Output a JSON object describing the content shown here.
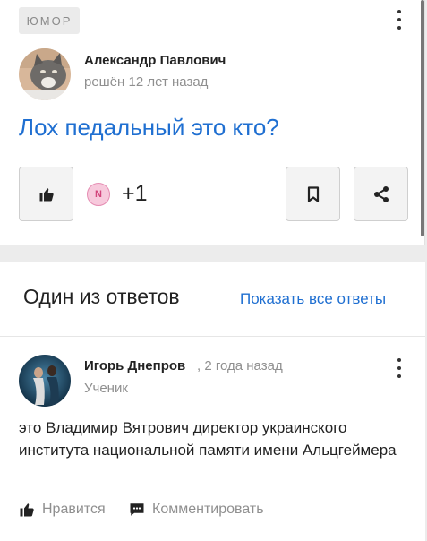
{
  "question": {
    "category": "ЮМОР",
    "author": "Александр Павлович",
    "meta": "решён 12 лет назад",
    "title": "Лох педальный это кто?",
    "vote_badge": "N",
    "vote_count": "+1"
  },
  "answers_section": {
    "heading": "Один из ответов",
    "show_all": "Показать все ответы"
  },
  "answer": {
    "author": "Игорь Днепров",
    "meta": ", 2 года назад",
    "rank": "Ученик",
    "text": "это Владимир Вятрович директор украинского института национальной памяти имени Альцгеймера",
    "like_label": "Нравится",
    "comment_label": "Комментировать"
  },
  "colors": {
    "link": "#1f6fd1",
    "muted": "#8f8f8f",
    "badge_bg": "#ebebeb"
  },
  "icons": {
    "menu": "more-vertical-icon",
    "like": "thumbs-up-icon",
    "save": "bookmark-icon",
    "share": "share-icon",
    "comment": "comment-icon"
  }
}
